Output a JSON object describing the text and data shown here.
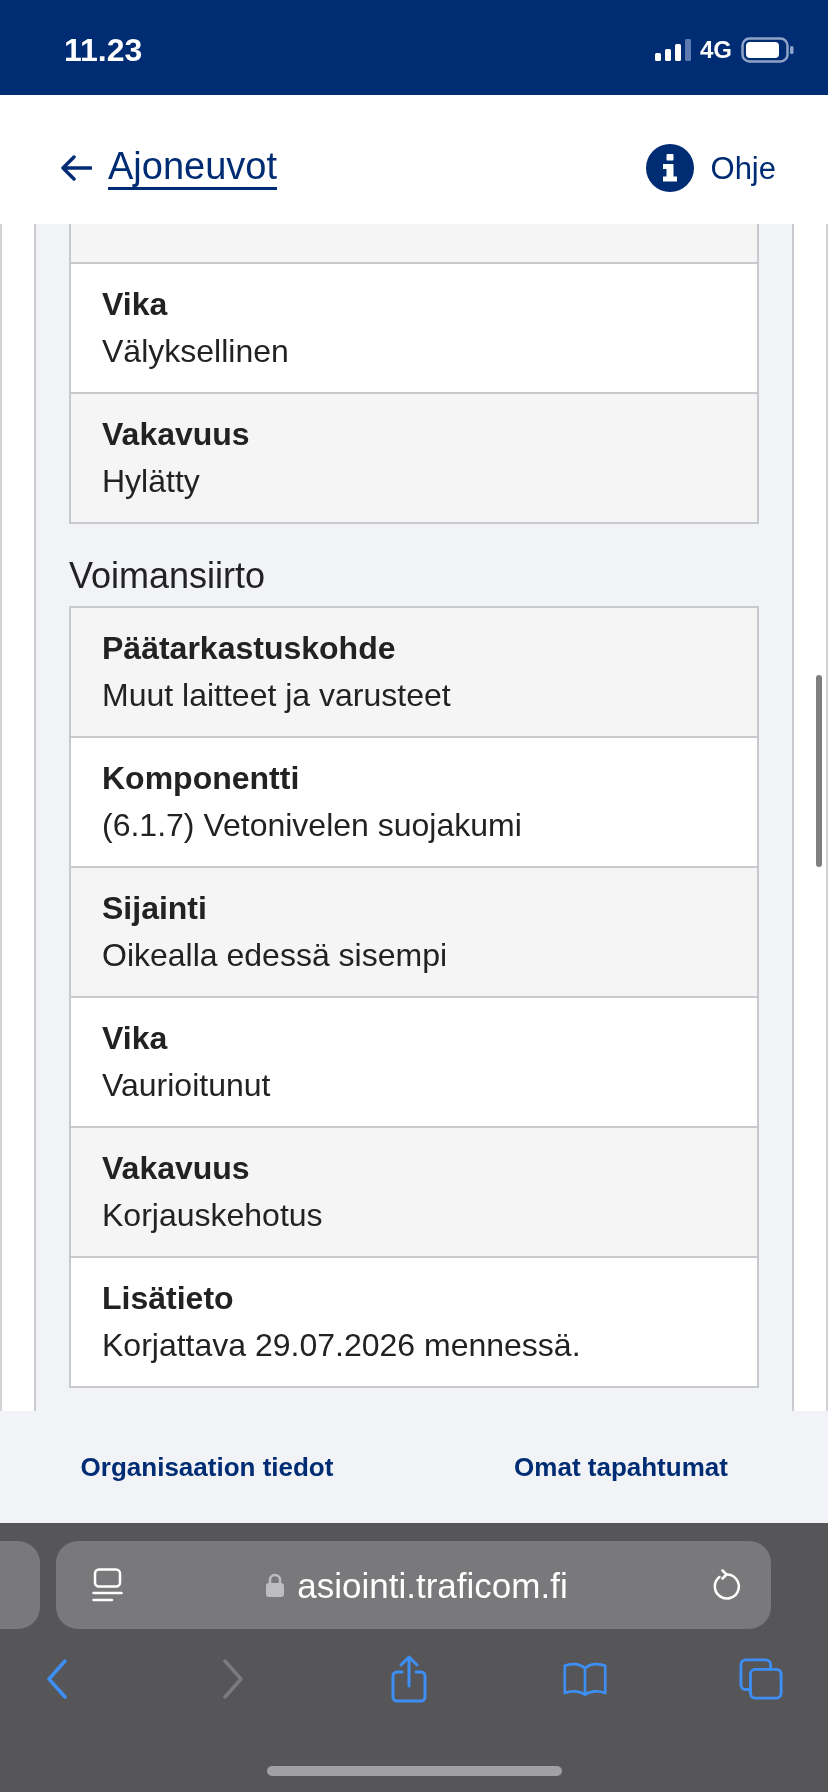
{
  "status_bar": {
    "time": "11.23",
    "network": "4G"
  },
  "header": {
    "back_link": "Ajoneuvot",
    "help_link": "Ohje"
  },
  "sections": [
    {
      "continued_from_above": true,
      "rows": [
        {
          "label": "Vika",
          "value": "Välyksellinen"
        },
        {
          "label": "Vakavuus",
          "value": "Hylätty"
        }
      ]
    },
    {
      "title": "Voimansiirto",
      "continued_from_above": false,
      "rows": [
        {
          "label": "Päätarkastuskohde",
          "value": "Muut laitteet ja varusteet"
        },
        {
          "label": "Komponentti",
          "value": "(6.1.7) Vetonivelen suojakumi"
        },
        {
          "label": "Sijainti",
          "value": "Oikealla edessä sisempi"
        },
        {
          "label": "Vika",
          "value": "Vaurioitunut"
        },
        {
          "label": "Vakavuus",
          "value": "Korjauskehotus"
        },
        {
          "label": "Lisätieto",
          "value": "Korjattava 29.07.2026 mennessä."
        }
      ]
    }
  ],
  "footer_links": [
    "Organisaation tiedot",
    "Omat tapahtumat"
  ],
  "browser": {
    "url": "asiointi.traficom.fi",
    "toolbar": [
      {
        "kind": "back",
        "disabled": false
      },
      {
        "kind": "forward",
        "disabled": true
      },
      {
        "kind": "share",
        "disabled": false
      },
      {
        "kind": "bookmarks",
        "disabled": false
      },
      {
        "kind": "tabs",
        "disabled": false
      }
    ]
  }
}
